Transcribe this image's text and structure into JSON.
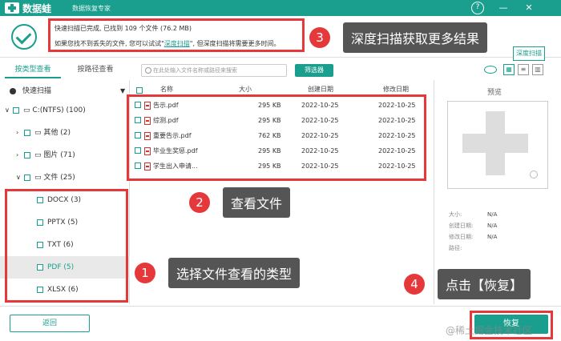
{
  "titlebar": {
    "app_name": "数据蛙",
    "subtitle": "数据恢复专家",
    "help_glyph": "?",
    "min_glyph": "—",
    "close_glyph": "✕"
  },
  "status": {
    "line1": "快速扫描已完成, 已找到 109 个文件 (76.2 MB)",
    "line2_a": "如果您找不到丢失的文件, 您可以试试\"",
    "deep_scan_link": "深度扫描",
    "line2_b": "\", 但深度扫描将需要更多时间。",
    "deep_scan_button": "深度扫描"
  },
  "callouts": {
    "c1": {
      "number": "1",
      "text": "选择文件查看的类型"
    },
    "c2": {
      "number": "2",
      "text": "查看文件"
    },
    "c3": {
      "number": "3",
      "text": "深度扫描获取更多结果"
    },
    "c4": {
      "number": "4",
      "text": "点击【恢复】"
    }
  },
  "tabs": [
    "按类型查看",
    "按路径查看"
  ],
  "scan_mode": "快速扫描",
  "tree": {
    "drive": "C:(NTFS) (100)",
    "other": "其他 (2)",
    "pictures": "图片 (71)",
    "documents": "文件 (25)",
    "docx": "DOCX (3)",
    "pptx": "PPTX (5)",
    "txt": "TXT (6)",
    "pdf": "PDF (5)",
    "xlsx": "XLSX (6)"
  },
  "search": {
    "placeholder": "在此处输入文件名称或路径来搜索"
  },
  "filter_button": "筛选器",
  "columns": {
    "name": "名称",
    "size": "大小",
    "created": "创建日期",
    "modified": "修改日期"
  },
  "files": [
    {
      "name": "告示.pdf",
      "size": "295 KB",
      "created": "2022-10-25",
      "modified": "2022-10-25"
    },
    {
      "name": "综测.pdf",
      "size": "295 KB",
      "created": "2022-10-25",
      "modified": "2022-10-25"
    },
    {
      "name": "重要告示.pdf",
      "size": "762 KB",
      "created": "2022-10-25",
      "modified": "2022-10-25"
    },
    {
      "name": "毕业生奖惩.pdf",
      "size": "295 KB",
      "created": "2022-10-25",
      "modified": "2022-10-25"
    },
    {
      "name": "学生出入申请...",
      "size": "295 KB",
      "created": "2022-10-25",
      "modified": "2022-10-25"
    }
  ],
  "preview": {
    "title": "预览",
    "size_label": "大小:",
    "size_value": "N/A",
    "created_label": "创建日期:",
    "created_value": "N/A",
    "modified_label": "修改日期:",
    "modified_value": "N/A",
    "path_label": "路径:"
  },
  "footer": {
    "back": "返回",
    "recover": "恢复"
  },
  "watermark": "@稀土掘金技术社区",
  "colors": {
    "accent": "#1a9e8e",
    "highlight": "#e5383b",
    "callout_bg": "#555555"
  }
}
